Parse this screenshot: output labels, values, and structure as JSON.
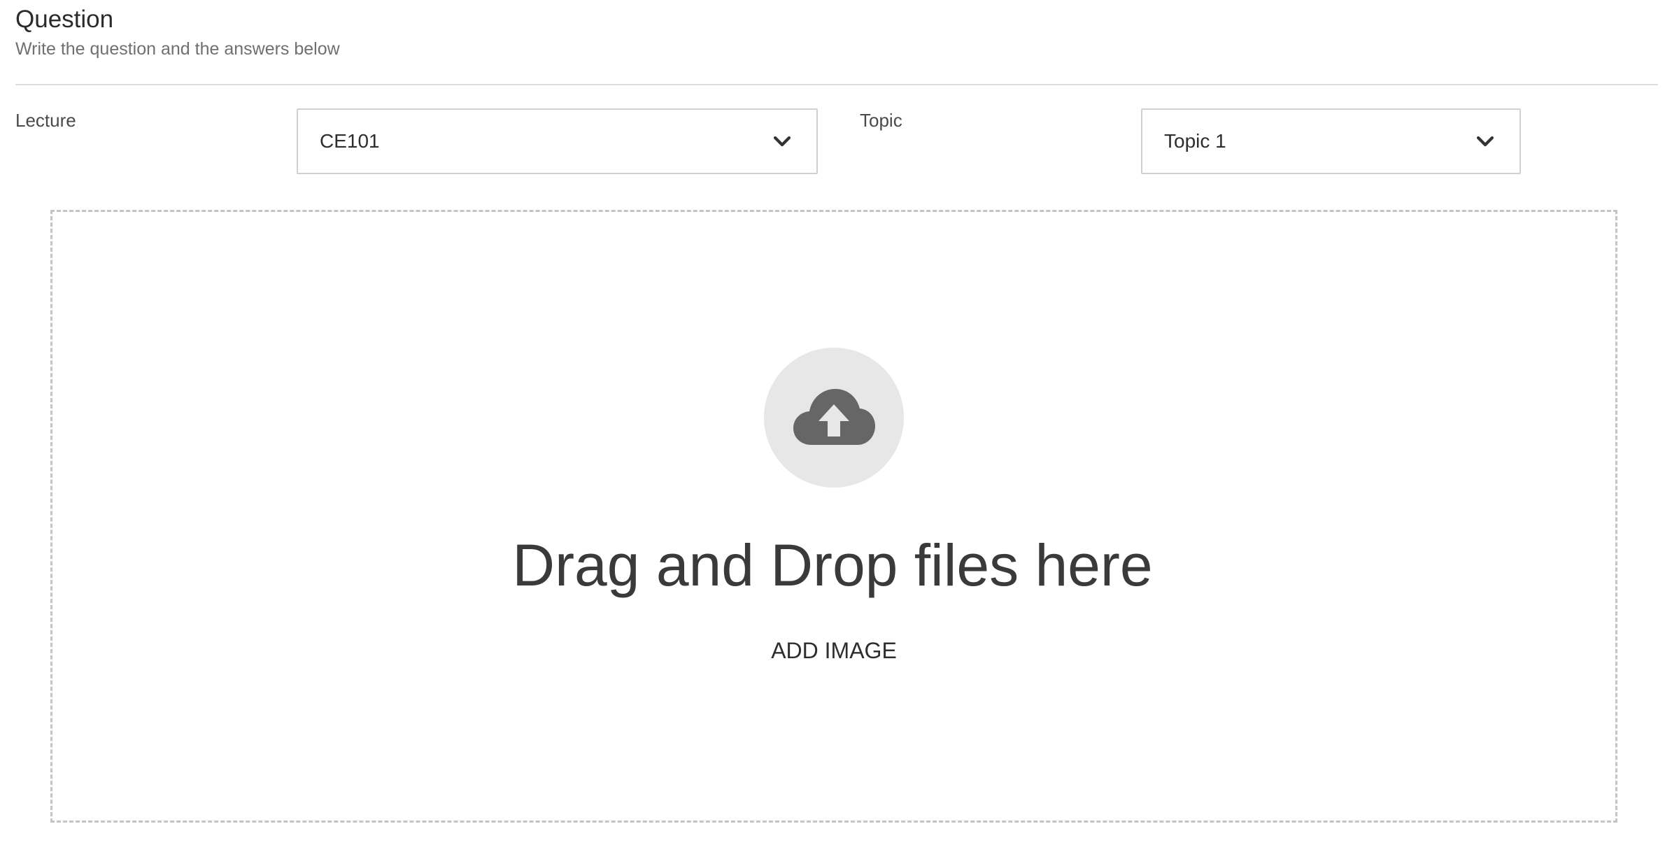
{
  "header": {
    "title": "Question",
    "subtitle": "Write the question and the answers below"
  },
  "lecture": {
    "label": "Lecture",
    "selected": "CE101"
  },
  "topic": {
    "label": "Topic",
    "selected": "Topic 1"
  },
  "dropzone": {
    "icon": "cloud-upload-icon",
    "message": "Drag and Drop files here",
    "button_label": "ADD IMAGE"
  },
  "colors": {
    "border": "#d0d0d0",
    "dashed_border": "#c4c4c4",
    "icon_circle": "#e7e7e7",
    "icon": "#666666"
  }
}
